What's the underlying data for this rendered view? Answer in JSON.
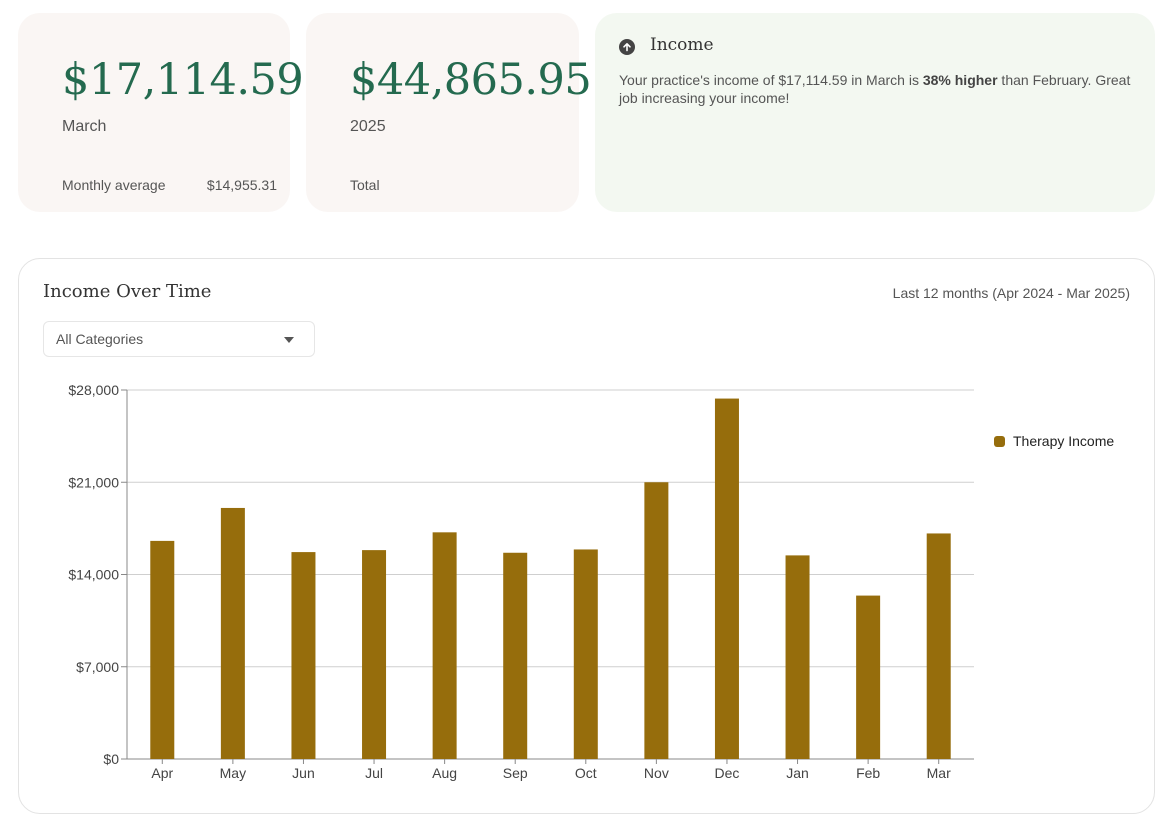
{
  "month_card": {
    "value": "$17,114.59",
    "label": "March",
    "foot_label": "Monthly average",
    "foot_value": "$14,955.31"
  },
  "year_card": {
    "value": "$44,865.95",
    "label": "2025",
    "foot_label": "Total"
  },
  "insight": {
    "icon": "arrow-up-circle-icon",
    "title": "Income",
    "text_before": "Your practice's income of $17,114.59 in March is ",
    "text_bold": "38% higher",
    "text_after": " than February. Great job increasing your income!"
  },
  "chart_card": {
    "title": "Income Over Time",
    "range": "Last 12 months (Apr 2024 - Mar 2025)",
    "category_select": "All Categories"
  },
  "colors": {
    "accent": "#246a4f",
    "bar": "#966d0c"
  },
  "chart_data": {
    "type": "bar",
    "categories": [
      "Apr",
      "May",
      "Jun",
      "Jul",
      "Aug",
      "Sep",
      "Oct",
      "Nov",
      "Dec",
      "Jan",
      "Feb",
      "Mar"
    ],
    "series": [
      {
        "name": "Therapy Income",
        "values": [
          16550,
          19050,
          15700,
          15850,
          17200,
          15650,
          15900,
          21000,
          27350,
          15450,
          12400,
          17115
        ]
      }
    ],
    "ylim": [
      0,
      28000
    ],
    "yticks": [
      0,
      7000,
      14000,
      21000,
      28000
    ],
    "ytick_labels": [
      "$0",
      "$7,000",
      "$14,000",
      "$21,000",
      "$28,000"
    ],
    "grid": true,
    "legend": "right"
  }
}
